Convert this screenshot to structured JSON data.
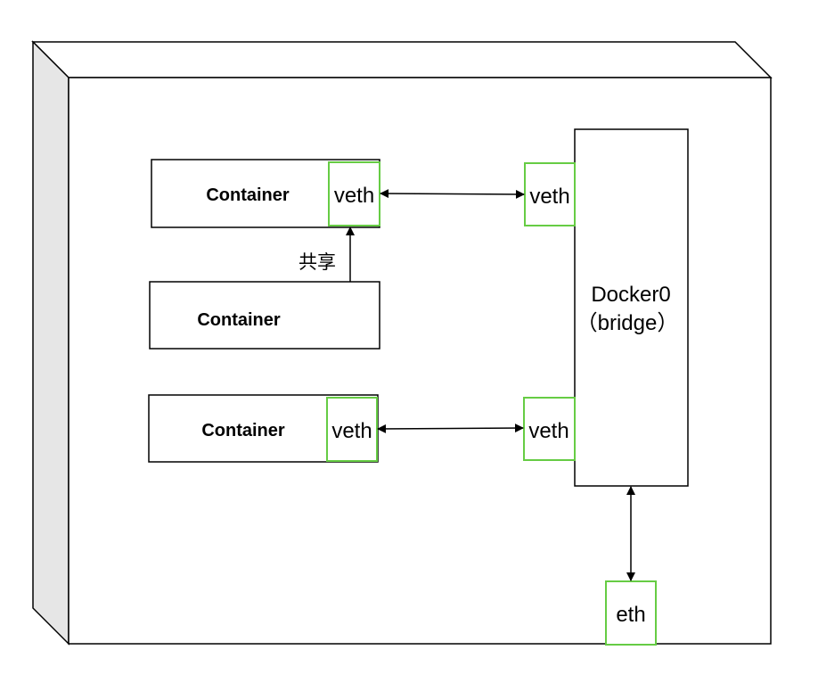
{
  "containers": [
    {
      "label": "Container",
      "veth": "veth"
    },
    {
      "label": "Container"
    },
    {
      "label": "Container",
      "veth": "veth"
    }
  ],
  "share_label": "共享",
  "bridge": {
    "title": "Docker0",
    "subtitle": "（bridge）",
    "ports": [
      "veth",
      "veth"
    ]
  },
  "host_port": "eth",
  "colors": {
    "port_border": "#66cc44",
    "host_side": "#e6e6e6",
    "stroke": "#000000"
  }
}
